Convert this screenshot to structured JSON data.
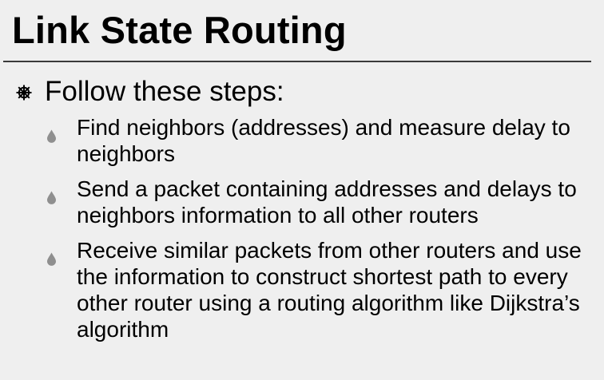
{
  "slide": {
    "title": "Link State Routing",
    "main_point": "Follow these steps:",
    "main_bullet_icon": "ornate-wheel-icon",
    "sub_bullet_icon": "drop-icon",
    "sub_points": [
      "Find neighbors (addresses) and measure delay to neighbors",
      "Send a packet containing addresses and delays to neighbors information to all other routers",
      "Receive similar packets from other routers and use the information to construct shortest path to every other router using a routing algorithm like Dijkstra’s algorithm"
    ]
  }
}
